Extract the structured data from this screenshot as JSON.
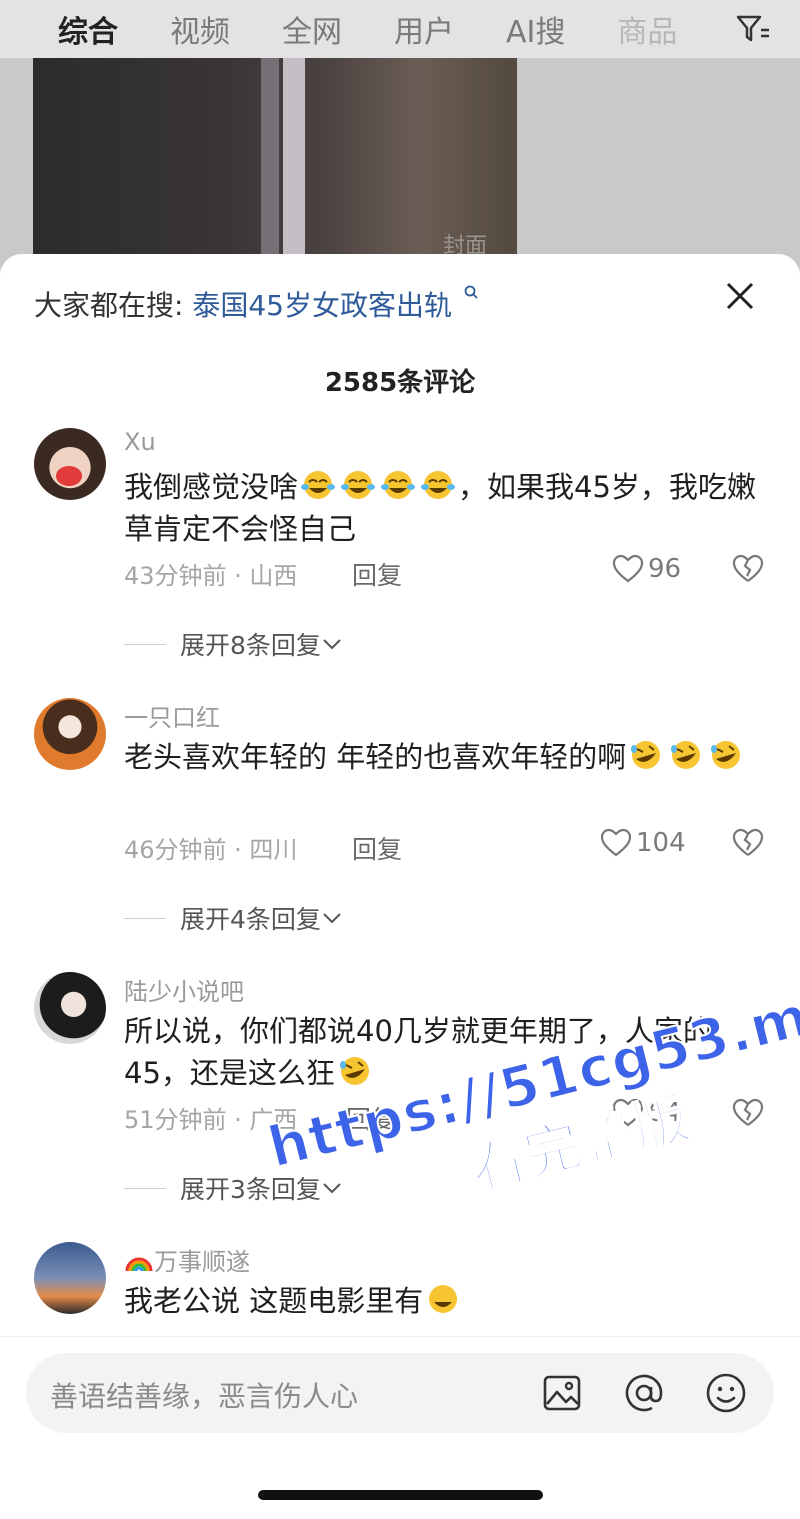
{
  "tabs": [
    "综合",
    "视频",
    "全网",
    "用户",
    "AI搜",
    "商品"
  ],
  "video": {
    "cover_label": "封面"
  },
  "sheet": {
    "hot_search_label": "大家都在搜:",
    "hot_search_keyword": "泰国45岁女政客出轨",
    "comment_count": "2585条评论"
  },
  "comments": [
    {
      "user": "Xu",
      "text_before": "我倒感觉没啥",
      "text_after": "，如果我45岁，我吃嫩草肯定不会怪自己",
      "time_location": "43分钟前 · 山西",
      "reply_label": "回复",
      "likes": "96",
      "expand": "展开8条回复"
    },
    {
      "user": "一只口红",
      "text_before": "老头喜欢年轻的 年轻的也喜欢年轻的啊",
      "text_after": "",
      "time_location": "46分钟前 · 四川",
      "reply_label": "回复",
      "likes": "104",
      "expand": "展开4条回复"
    },
    {
      "user": "陆少小说吧",
      "text_before": "所以说，你们都说40几岁就更年期了，人家的45，还是这么狂",
      "text_after": "",
      "time_location": "51分钟前 · 广西",
      "reply_label": "回复",
      "likes": "64",
      "expand": "展开3条回复"
    },
    {
      "user": "万事顺遂",
      "text_before": "我老公说 这题电影里有",
      "text_after": ""
    }
  ],
  "watermark": {
    "line1": "https://51cg53.me",
    "line2": "看完整版"
  },
  "input": {
    "placeholder": "善语结善缘，恶言伤人心"
  },
  "icons": [
    "filter-icon",
    "search-icon",
    "close-icon",
    "heart-icon",
    "broken-heart-icon",
    "chevron-down-icon",
    "image-icon",
    "at-icon",
    "emoji-icon"
  ],
  "colors": {
    "keyword": "#2f5b9a",
    "watermark": "#3d63e8"
  }
}
